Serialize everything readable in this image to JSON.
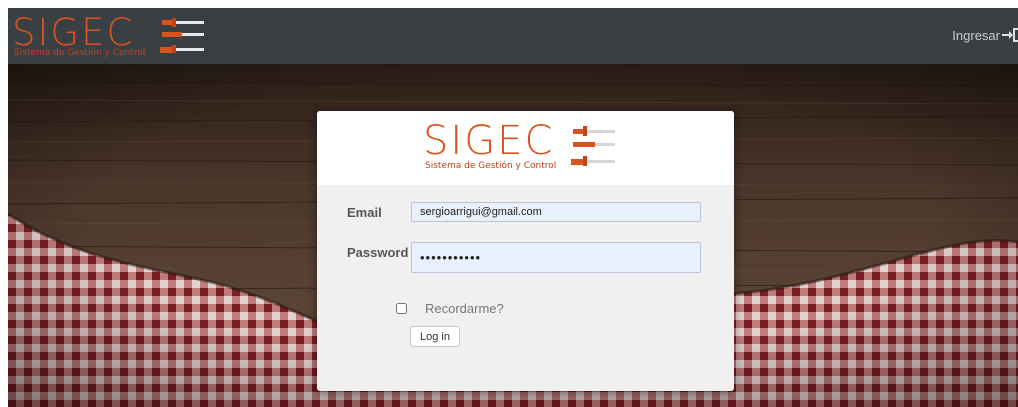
{
  "navbar": {
    "brand_title": "SIGEC",
    "brand_subtitle": "Sistema de Gestión y Control",
    "login_label": "Ingresar",
    "login_icon": "sign-in-icon"
  },
  "login_card": {
    "logo_title": "SIGEC",
    "logo_subtitle": "Sistema de Gestión y Control",
    "email_label": "Email",
    "email_value": "sergioarrigui@gmail.com",
    "password_label": "Password",
    "password_mask": "•••••••••••",
    "remember_label": "Recordarme?",
    "remember_checked": false,
    "submit_label": "Log in"
  },
  "colors": {
    "brand_orange": "#d9531e",
    "navbar_bg": "#3a3f44",
    "input_bg": "#e8f0fe",
    "card_bg": "#f0f0f0"
  },
  "background": {
    "description_icon": "wood-table-checkered-cloth"
  }
}
